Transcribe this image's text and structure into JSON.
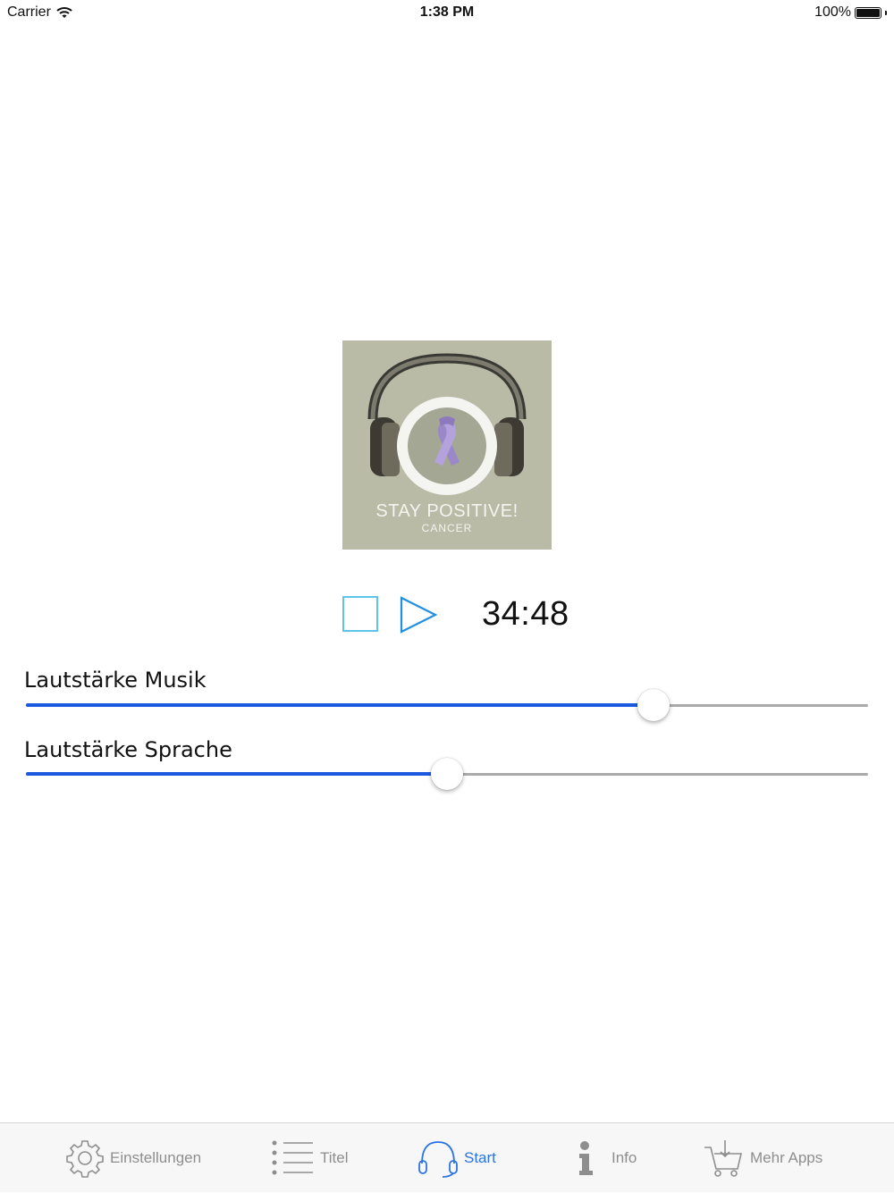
{
  "status_bar": {
    "carrier": "Carrier",
    "time": "1:38 PM",
    "battery": "100%"
  },
  "artwork": {
    "title": "STAY POSITIVE!",
    "subtitle": "CANCER",
    "background_color": "#b9bba6",
    "ribbon_color": "#a08ccc"
  },
  "player": {
    "time_remaining": "34:48",
    "accent_color": "#5ec4ec"
  },
  "sliders": [
    {
      "label": "Lautstärke Musik",
      "value": 0.745
    },
    {
      "label": "Lautstärke Sprache",
      "value": 0.5
    }
  ],
  "tab_bar": {
    "active_color": "#2b74e6",
    "inactive_color": "#8e8e8e",
    "tabs": [
      {
        "label": "Einstellungen",
        "icon": "gear-icon",
        "active": false
      },
      {
        "label": "Titel",
        "icon": "list-icon",
        "active": false
      },
      {
        "label": "Start",
        "icon": "headphones-icon",
        "active": true
      },
      {
        "label": "Info",
        "icon": "info-icon",
        "active": false
      },
      {
        "label": "Mehr Apps",
        "icon": "cart-icon",
        "active": false
      }
    ]
  }
}
